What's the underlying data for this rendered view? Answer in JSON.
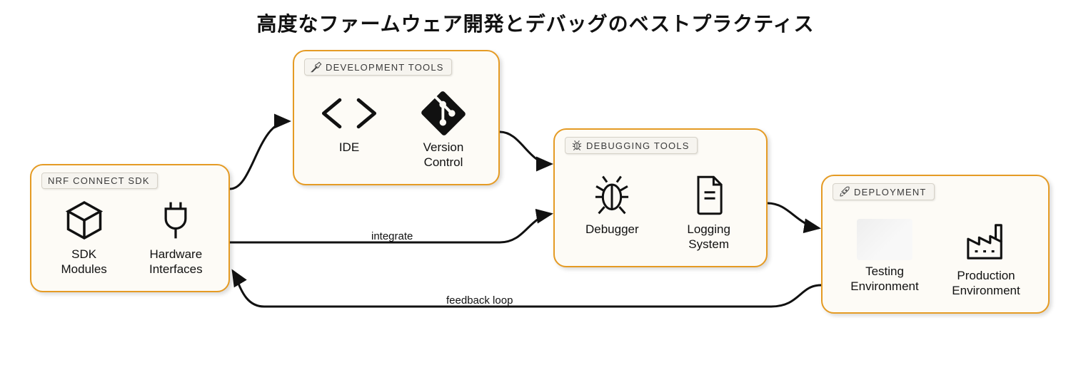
{
  "title": "高度なファームウェア開発とデバッグのベストプラクティス",
  "cards": {
    "sdk": {
      "tag": "NRF CONNECT SDK",
      "item1": "SDK\nModules",
      "item2": "Hardware\nInterfaces"
    },
    "dev": {
      "tag": "DEVELOPMENT TOOLS",
      "item1": "IDE",
      "item2": "Version\nControl"
    },
    "debug": {
      "tag": "DEBUGGING TOOLS",
      "item1": "Debugger",
      "item2": "Logging\nSystem"
    },
    "deploy": {
      "tag": "DEPLOYMENT",
      "item1": "Testing\nEnvironment",
      "item2": "Production\nEnvironment"
    }
  },
  "edges": {
    "integrate": "integrate",
    "feedback": "feedback loop"
  }
}
